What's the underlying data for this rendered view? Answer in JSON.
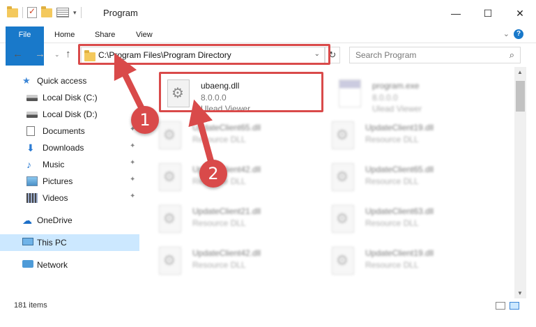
{
  "window": {
    "title": "Program",
    "minimize": "—",
    "maximize": "☐",
    "close": "✕"
  },
  "ribbon": {
    "tabs": [
      "File",
      "Home",
      "Share",
      "View"
    ],
    "expand": "⌄",
    "help": "?"
  },
  "nav": {
    "back": "←",
    "forward": "→",
    "recent": "⌄",
    "up": "↑",
    "address": "C:\\Program Files\\Program Directory",
    "address_dropdown": "⌄",
    "refresh": "↻",
    "search_placeholder": "Search Program",
    "search_icon": "⌕"
  },
  "sidebar": {
    "quick_access": "Quick access",
    "items": [
      {
        "label": "Local Disk (C:)",
        "icon": "disk-icon",
        "pinned": false
      },
      {
        "label": "Local Disk (D:)",
        "icon": "disk-icon",
        "pinned": false
      },
      {
        "label": "Documents",
        "icon": "documents-icon",
        "pinned": true
      },
      {
        "label": "Downloads",
        "icon": "downloads-icon",
        "pinned": true
      },
      {
        "label": "Music",
        "icon": "music-icon",
        "pinned": true
      },
      {
        "label": "Pictures",
        "icon": "pictures-icon",
        "pinned": true
      },
      {
        "label": "Videos",
        "icon": "videos-icon",
        "pinned": true
      }
    ],
    "pin_glyph": "📌",
    "onedrive": "OneDrive",
    "this_pc": "This PC",
    "network": "Network"
  },
  "files": [
    {
      "name": "ubaeng.dll",
      "line1": "8.0.0.0",
      "line2": "Ulead Viewer",
      "highlighted": true
    },
    {
      "name": "program.exe",
      "line1": "8.0.0.0",
      "line2": "Ulead Viewer",
      "highlighted": false
    },
    {
      "name": "UpdateClient65.dll",
      "line1": "Resource DLL",
      "highlighted": false
    },
    {
      "name": "UpdateClient19.dll",
      "line1": "Resource DLL",
      "highlighted": false
    },
    {
      "name": "UpdateClient42.dll",
      "line1": "Resource DLL",
      "highlighted": false
    },
    {
      "name": "UpdateClient65.dll",
      "line1": "Resource DLL",
      "highlighted": false
    },
    {
      "name": "UpdateClient21.dll",
      "line1": "Resource DLL",
      "highlighted": false
    },
    {
      "name": "UpdateClient63.dll",
      "line1": "Resource DLL",
      "highlighted": false
    },
    {
      "name": "UpdateClient42.dll",
      "line1": "Resource DLL",
      "highlighted": false
    },
    {
      "name": "UpdateClient19.dll",
      "line1": "Resource DLL",
      "highlighted": false
    }
  ],
  "status": {
    "item_count": "181 items"
  },
  "annotations": {
    "step1": "1",
    "step2": "2",
    "color": "#d94a4a"
  },
  "colors": {
    "accent": "#1979ca",
    "selected": "#cce8ff"
  }
}
